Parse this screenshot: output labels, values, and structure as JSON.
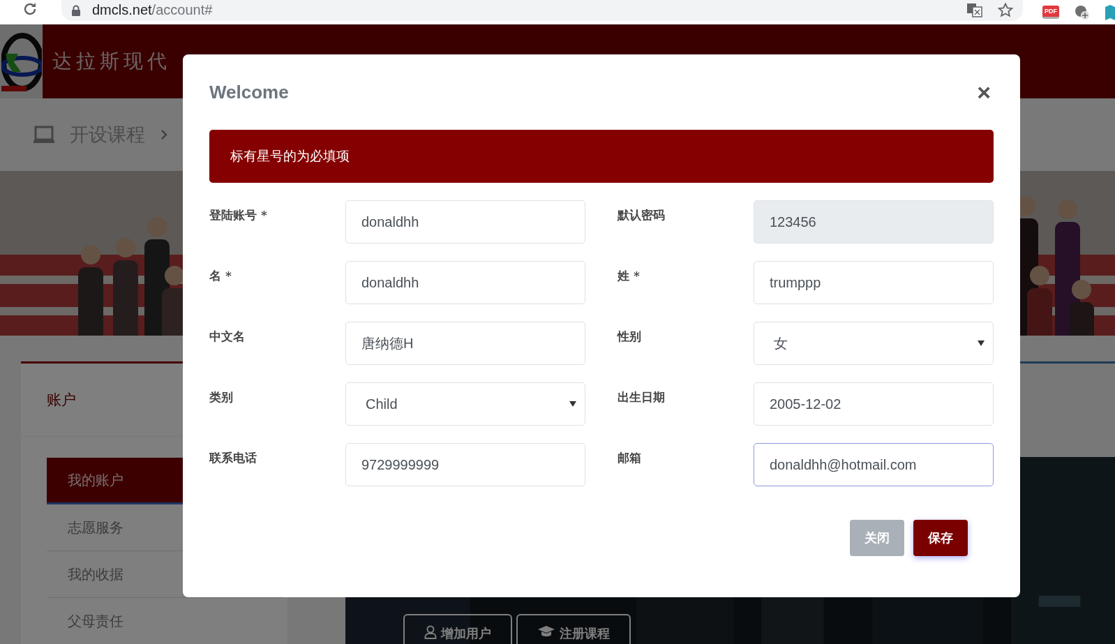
{
  "browser": {
    "url_host": "dmcls.net",
    "url_path": "/account#",
    "pdf_badge": "PDF"
  },
  "site": {
    "title": "达拉斯现代",
    "breadcrumb": "开设课程",
    "sidebar": {
      "heading": "账户",
      "items": [
        {
          "label": "我的账户",
          "selected": true
        },
        {
          "label": "志愿服务",
          "selected": false
        },
        {
          "label": "我的收据",
          "selected": false
        },
        {
          "label": "父母责任",
          "selected": false
        }
      ]
    },
    "actions": [
      {
        "label": "增加用户",
        "kind": "user"
      },
      {
        "label": "注册课程",
        "kind": "course"
      }
    ]
  },
  "modal": {
    "title": "Welcome",
    "close": "×",
    "notice": "标有星号的为必填项",
    "fields": [
      {
        "label": "登陆账号 *",
        "value": "donaldhh",
        "kind": "text",
        "disabled": false,
        "focused": false
      },
      {
        "label": "默认密码",
        "value": "123456",
        "kind": "text",
        "disabled": true,
        "focused": false
      },
      {
        "label": "名 *",
        "value": "donaldhh",
        "kind": "text",
        "disabled": false,
        "focused": false
      },
      {
        "label": "姓 *",
        "value": "trumppp",
        "kind": "text",
        "disabled": false,
        "focused": false
      },
      {
        "label": "中文名",
        "value": "唐纳德H",
        "kind": "text",
        "disabled": false,
        "focused": false
      },
      {
        "label": "性别",
        "value": "女",
        "kind": "select",
        "disabled": false,
        "focused": false
      },
      {
        "label": "类别",
        "value": "Child",
        "kind": "select",
        "disabled": false,
        "focused": false
      },
      {
        "label": "出生日期",
        "value": "2005-12-02",
        "kind": "text",
        "disabled": false,
        "focused": false
      },
      {
        "label": "联系电话",
        "value": "9729999999",
        "kind": "text",
        "disabled": false,
        "focused": false
      },
      {
        "label": "邮箱",
        "value": "donaldhh@hotmail.com",
        "kind": "text",
        "disabled": false,
        "focused": true
      }
    ],
    "buttons": [
      {
        "label": "关闭",
        "kind": "secondary"
      },
      {
        "label": "保存",
        "kind": "primary"
      }
    ]
  }
}
